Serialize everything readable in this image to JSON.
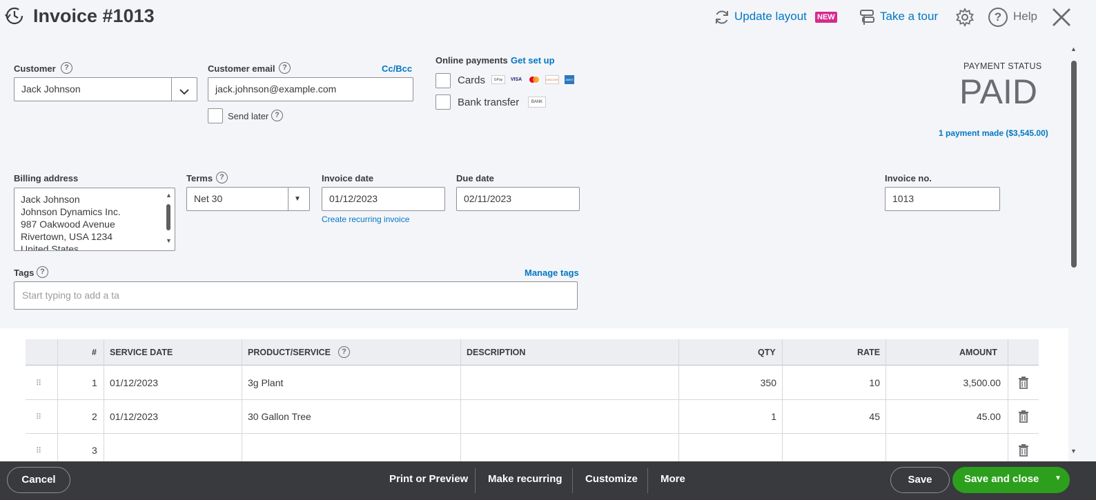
{
  "header": {
    "title": "Invoice #1013",
    "update_layout": "Update layout",
    "new_badge": "NEW",
    "take_tour": "Take a tour",
    "help": "Help"
  },
  "customer": {
    "label": "Customer",
    "value": "Jack Johnson"
  },
  "email": {
    "label": "Customer email",
    "value": "jack.johnson@example.com",
    "cc_bcc": "Cc/Bcc",
    "send_later": "Send later"
  },
  "online_payments": {
    "label": "Online payments",
    "setup_link": "Get set up",
    "cards": "Cards",
    "bank_transfer": "Bank transfer",
    "card_logos": [
      "GPay",
      "VISA",
      "MC",
      "DISCOVER",
      "AMEX"
    ],
    "bank_logo": "BANK"
  },
  "payment_status": {
    "label": "PAYMENT STATUS",
    "value": "PAID",
    "payments_link": "1 payment made ($3,545.00)"
  },
  "billing": {
    "label": "Billing address",
    "lines": [
      "Jack Johnson",
      "Johnson Dynamics Inc.",
      "987 Oakwood Avenue",
      "Rivertown, USA  1234",
      "United States"
    ]
  },
  "terms": {
    "label": "Terms",
    "value": "Net 30"
  },
  "invoice_date": {
    "label": "Invoice date",
    "value": "01/12/2023",
    "recurring_link": "Create recurring invoice"
  },
  "due_date": {
    "label": "Due date",
    "value": "02/11/2023"
  },
  "invoice_no": {
    "label": "Invoice no.",
    "value": "1013"
  },
  "tags": {
    "label": "Tags",
    "manage": "Manage tags",
    "placeholder": "Start typing to add a ta"
  },
  "table": {
    "headers": {
      "num": "#",
      "service_date": "SERVICE DATE",
      "product": "PRODUCT/SERVICE",
      "description": "DESCRIPTION",
      "qty": "QTY",
      "rate": "RATE",
      "amount": "AMOUNT"
    },
    "rows": [
      {
        "num": "1",
        "date": "01/12/2023",
        "product": "3g Plant",
        "description": "",
        "qty": "350",
        "rate": "10",
        "amount": "3,500.00"
      },
      {
        "num": "2",
        "date": "01/12/2023",
        "product": "30 Gallon Tree",
        "description": "",
        "qty": "1",
        "rate": "45",
        "amount": "45.00"
      },
      {
        "num": "3",
        "date": "",
        "product": "",
        "description": "",
        "qty": "",
        "rate": "",
        "amount": ""
      }
    ]
  },
  "footer": {
    "cancel": "Cancel",
    "print": "Print or Preview",
    "recurring": "Make recurring",
    "customize": "Customize",
    "more": "More",
    "save": "Save",
    "save_close": "Save and close"
  },
  "colors": {
    "link": "#0077c5",
    "green": "#2ca01c",
    "footer_bg": "#393a3d",
    "new_badge": "#d52b8d"
  }
}
